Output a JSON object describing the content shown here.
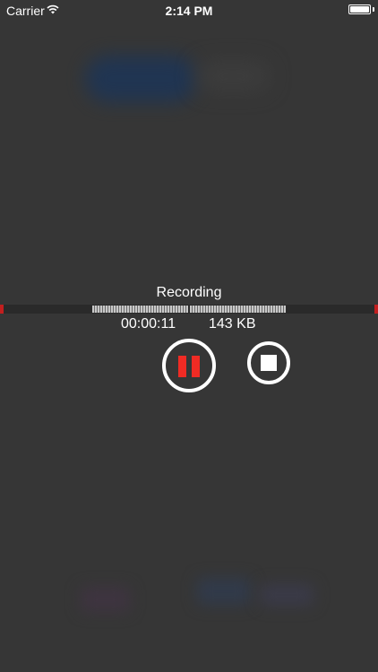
{
  "status_bar": {
    "carrier": "Carrier",
    "time": "2:14 PM",
    "wifi_icon": "wifi-icon",
    "battery_icon": "battery-icon"
  },
  "recorder": {
    "title": "Recording",
    "elapsed": "00:00:11",
    "size": "143 KB",
    "pause_icon": "pause-icon",
    "stop_icon": "stop-icon",
    "accent_color": "#f02b24",
    "level_edge_color": "#c21f1f"
  }
}
